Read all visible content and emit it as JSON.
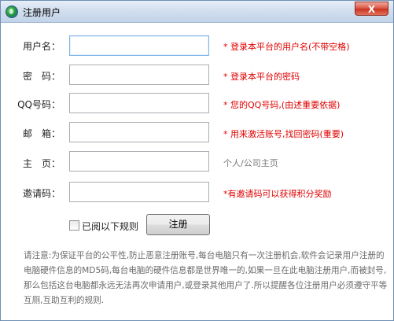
{
  "window": {
    "title": "注册用户",
    "close_label": "X"
  },
  "form": {
    "rows": [
      {
        "label": "用户名：",
        "value": "",
        "hint": "* 登录本平台的用户名(不带空格)",
        "hint_color": "red"
      },
      {
        "label": "密　码：",
        "value": "",
        "hint": "* 登录本平台的密码",
        "hint_color": "red"
      },
      {
        "label": "QQ号码：",
        "value": "",
        "hint": "* 您的QQ号码,(由述重要依据)",
        "hint_color": "red"
      },
      {
        "label": "邮　箱：",
        "value": "",
        "hint": "* 用来激活账号,找回密码(重要)",
        "hint_color": "red"
      },
      {
        "label": "主　页：",
        "value": "",
        "hint": "个人/公司主页",
        "hint_color": "gray"
      },
      {
        "label": "邀请码：",
        "value": "",
        "hint": "*有邀请码可以获得积分奖励",
        "hint_color": "red"
      }
    ],
    "agree_label": "已阅以下规则",
    "agree_checked": false,
    "submit_label": "注册"
  },
  "notice": "请注意:为保证平台的公平性,防止恶意注册账号,每台电脑只有一次注册机会,软件会记录用户注册的电脑硬件信息的MD5码,每台电脑的硬件信息都是世界唯一的,如果一旦在此电脑注册用户,而被封号,那么包括这台电脑都永远无法再次申请用户,或登录其他用户了.所以提醒各位注册用户必须遵守平等互厕,互助互利的规则.",
  "colors": {
    "hint_red": "#e00000",
    "hint_gray": "#7a7a7a",
    "notice_text": "#6a6a6a",
    "titlebar": "#cfdcec",
    "close_button": "#c7311d"
  }
}
